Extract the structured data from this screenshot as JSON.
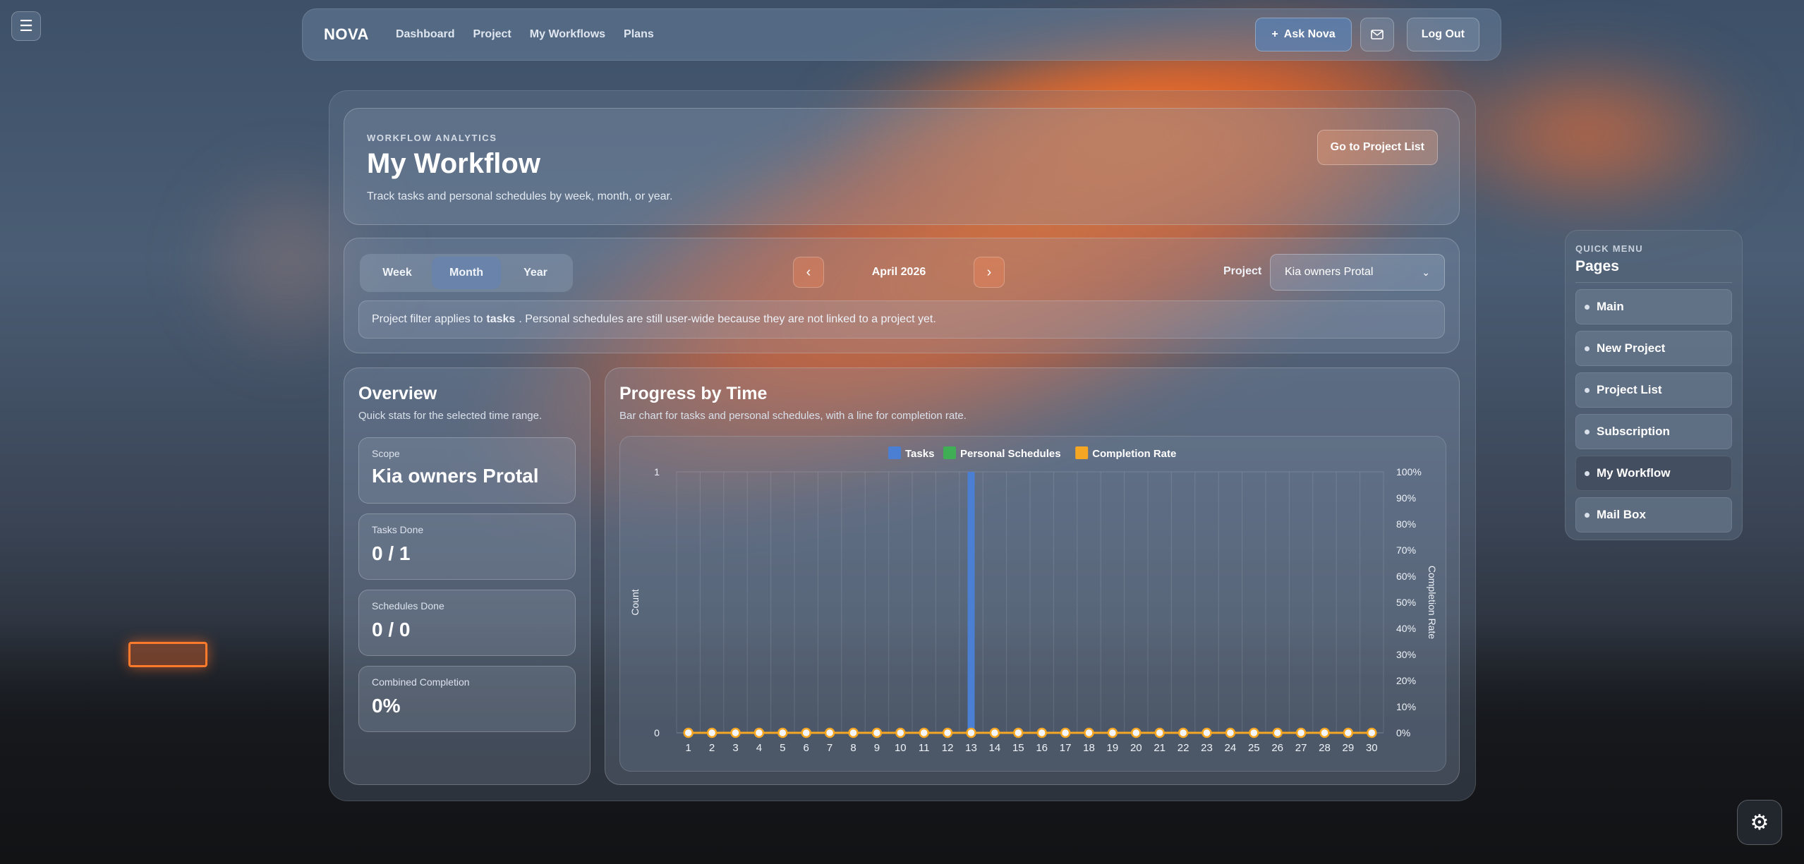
{
  "nav": {
    "menu_icon": "hamburger-icon",
    "brand": "NOVA",
    "links": [
      "Dashboard",
      "Project",
      "My Workflows",
      "Plans"
    ],
    "ask_label": "Ask Nova",
    "ask_icon": "plus-icon",
    "mail_icon": "mail-icon",
    "logout_label": "Log Out"
  },
  "hero": {
    "eyebrow": "WORKFLOW ANALYTICS",
    "title": "My Workflow",
    "subtitle": "Track tasks and personal schedules by week, month, or year.",
    "goto_label": "Go to Project List"
  },
  "filters": {
    "ranges": [
      "Week",
      "Month",
      "Year"
    ],
    "active_range": "Month",
    "period": "April 2026",
    "prev_icon": "chevron-left-icon",
    "next_icon": "chevron-right-icon",
    "project_label": "Project",
    "project_value": "Kia owners Protal",
    "notice_pre": "Project filter applies to",
    "notice_bold": "tasks",
    "notice_post": ". Personal schedules are still user-wide because they are not linked to a project yet."
  },
  "overview": {
    "title": "Overview",
    "subtitle": "Quick stats for the selected time range.",
    "scope_label": "Scope",
    "scope_value": "Kia owners Protal",
    "tasks_label": "Tasks Done",
    "tasks_value": "0 / 1",
    "schedules_label": "Schedules Done",
    "schedules_value": "0 / 0",
    "combined_label": "Combined Completion",
    "combined_value": "0%"
  },
  "progress": {
    "title": "Progress by Time",
    "subtitle": "Bar chart for tasks and personal schedules, with a line for completion rate."
  },
  "chart_data": {
    "type": "bar",
    "title": "",
    "categories": [
      "1",
      "2",
      "3",
      "4",
      "5",
      "6",
      "7",
      "8",
      "9",
      "10",
      "11",
      "12",
      "13",
      "14",
      "15",
      "16",
      "17",
      "18",
      "19",
      "20",
      "21",
      "22",
      "23",
      "24",
      "25",
      "26",
      "27",
      "28",
      "29",
      "30"
    ],
    "series": [
      {
        "name": "Tasks",
        "color": "#4a7fd4",
        "values": [
          0,
          0,
          0,
          0,
          0,
          0,
          0,
          0,
          0,
          0,
          0,
          0,
          1,
          0,
          0,
          0,
          0,
          0,
          0,
          0,
          0,
          0,
          0,
          0,
          0,
          0,
          0,
          0,
          0,
          0
        ]
      },
      {
        "name": "Personal Schedules",
        "color": "#3fae55",
        "values": [
          0,
          0,
          0,
          0,
          0,
          0,
          0,
          0,
          0,
          0,
          0,
          0,
          0,
          0,
          0,
          0,
          0,
          0,
          0,
          0,
          0,
          0,
          0,
          0,
          0,
          0,
          0,
          0,
          0,
          0
        ]
      },
      {
        "name": "Completion Rate",
        "type": "line",
        "axis": "right",
        "color": "#f5a623",
        "values": [
          0,
          0,
          0,
          0,
          0,
          0,
          0,
          0,
          0,
          0,
          0,
          0,
          0,
          0,
          0,
          0,
          0,
          0,
          0,
          0,
          0,
          0,
          0,
          0,
          0,
          0,
          0,
          0,
          0,
          0
        ]
      }
    ],
    "ylabel": "Count",
    "y_ticks": [
      "0",
      "1"
    ],
    "ylim": [
      0,
      1
    ],
    "y2label": "Completion Rate",
    "y2_ticks": [
      "0%",
      "10%",
      "20%",
      "30%",
      "40%",
      "50%",
      "60%",
      "70%",
      "80%",
      "90%",
      "100%"
    ],
    "y2lim": [
      0,
      100
    ],
    "legend": "top-center",
    "grid": true
  },
  "quick_menu": {
    "eyebrow": "QUICK MENU",
    "title": "Pages",
    "items": [
      "Main",
      "New Project",
      "Project List",
      "Subscription",
      "My Workflow",
      "Mail Box"
    ],
    "active": "My Workflow"
  },
  "settings_icon": "gear-icon"
}
